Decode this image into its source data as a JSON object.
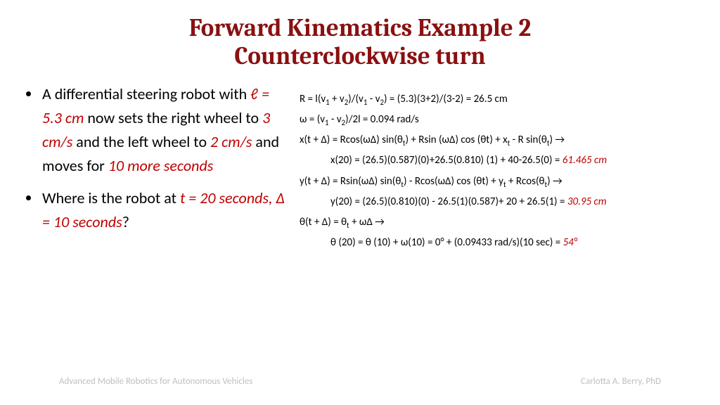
{
  "title_line1": "Forward Kinematics Example 2",
  "title_line2": "Counterclockwise turn",
  "bullet1": {
    "t1": "A differential steering robot with ",
    "l_eq": "ℓ = 5.3 cm",
    "t2": " now sets the right wheel to ",
    "v1": "3 cm/s",
    "t3": " and the left wheel to ",
    "v2": "2 cm/s",
    "t4": " and moves for ",
    "dur": "10 more seconds"
  },
  "bullet2": {
    "t1": "Where is the robot at ",
    "tval": "t = 20 seconds, ∆ = 10 seconds",
    "t2": "?"
  },
  "calc": {
    "r_a": "R = l(v",
    "r_b": " + v",
    "r_c": ")/(v",
    "r_d": " - v",
    "r_e": ") = (5.3)(3+2)/(3-2) = 26.5 cm",
    "w_a": "ω = (v",
    "w_b": " - v",
    "w_c": ")/2l = 0.094 rad/s",
    "x_a": "x(t + ∆) = Rcos(ω∆) sin(θ",
    "x_b": ") + Rsin (ω∆) cos (θt) + x",
    "x_c": " - R sin(θ",
    "x_d": ") →",
    "x20_a": "x(20) = (26.5)(0.587)(0)+26.5(0.810) (1) + 40-26.5(0) = ",
    "x20_ans": "61.465 cm",
    "y_a": "y(t +  ∆) =  Rsin(ω∆) sin(θ",
    "y_b": ")  -  Rcos(ω∆) cos (θt) + y",
    "y_c": " + Rcos(θ",
    "y_d": ") →",
    "y20_a": "y(20) = (26.5)(0.810)(0) - 26.5(1)(0.587)+ 20 + 26.5(1) = ",
    "y20_ans": "30.95 cm",
    "th_a": "θ(t + ∆) = θ",
    "th_b": " + ω∆ →",
    "th20_a": "θ (20) = θ (10) + ω(10) = 0° + (0.09433 rad/s)(10 sec) = ",
    "th20_ans": "54°"
  },
  "footer": {
    "left": "Advanced Mobile Robotics for Autonomous Vehicles",
    "right": "Carlotta A. Berry, PhD"
  }
}
